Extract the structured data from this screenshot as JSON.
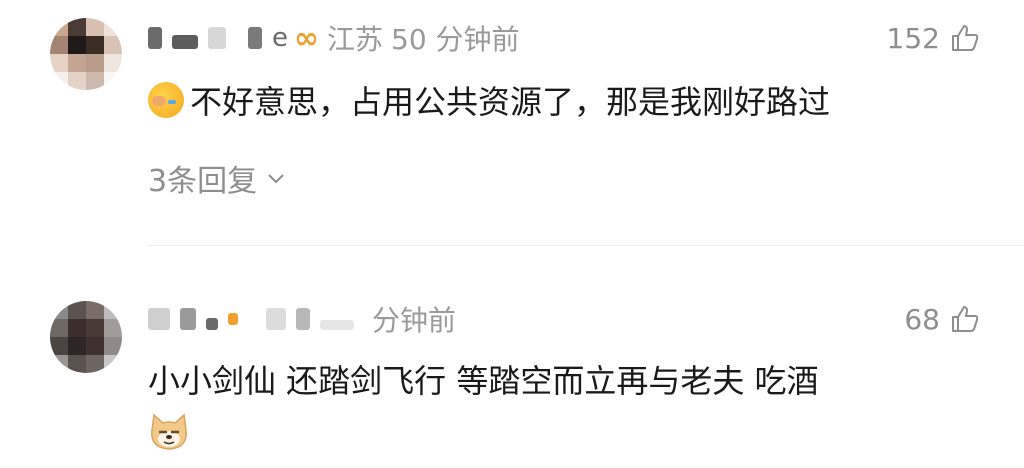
{
  "comments": [
    {
      "location": "江苏",
      "time": "50 分钟前",
      "likes": "152",
      "emoji": "face-palm-crying-emoji",
      "text": "不好意思，占用公共资源了，那是我刚好路过",
      "replies": "3条回复"
    },
    {
      "time": "分钟前",
      "likes": "68",
      "text": "小小剑仙 还踏剑飞行 等踏空而立再与老夫 吃酒",
      "emoji_after": "doge-emoji"
    }
  ],
  "colors": {
    "meta": "#9a9a9a",
    "text": "#1a1a1a",
    "vip": "#f0a030",
    "divider": "#ececec"
  }
}
